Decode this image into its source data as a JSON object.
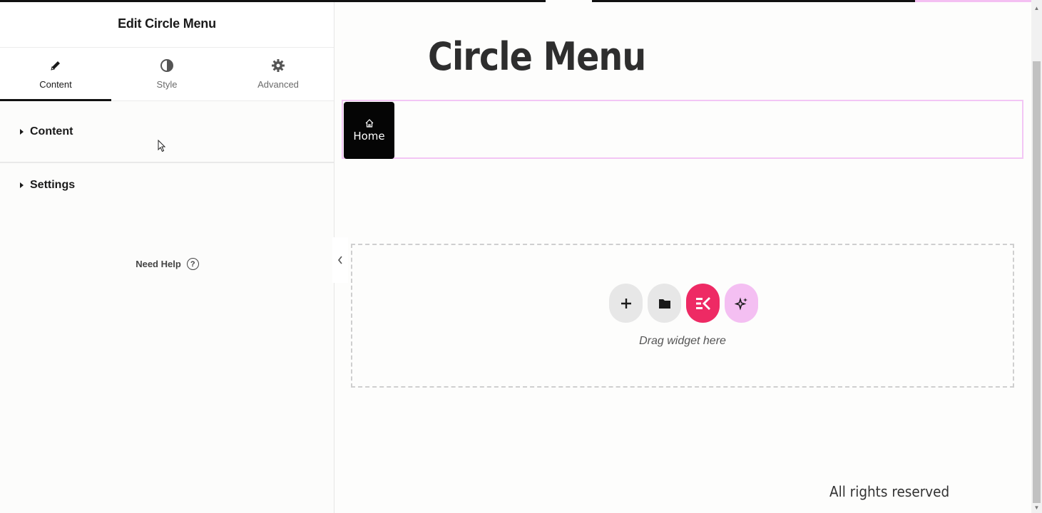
{
  "panel": {
    "title": "Edit Circle Menu",
    "tabs": [
      {
        "label": "Content",
        "icon": "pencil-icon",
        "active": true
      },
      {
        "label": "Style",
        "icon": "half-circle-icon",
        "active": false
      },
      {
        "label": "Advanced",
        "icon": "gear-icon",
        "active": false
      }
    ],
    "sections": [
      {
        "label": "Content"
      },
      {
        "label": "Settings"
      }
    ],
    "help_label": "Need Help",
    "help_icon": "question-icon",
    "collapse_icon": "chevron-left-icon"
  },
  "preview": {
    "page_title": "Circle Menu",
    "menu_item": {
      "label": "Home",
      "icon": "home-icon"
    },
    "dropzone": {
      "buttons": [
        {
          "name": "add-widget",
          "icon": "plus-icon",
          "color": "#e7e7e7"
        },
        {
          "name": "template-library",
          "icon": "folder-icon",
          "color": "#e7e7e7"
        },
        {
          "name": "elementskit",
          "icon": "elementskit-icon",
          "color": "#ee2a64"
        },
        {
          "name": "ai",
          "icon": "sparkle-icon",
          "color": "#f4bff2"
        }
      ],
      "hint": "Drag widget here"
    },
    "footer": "All rights reserved"
  },
  "colors": {
    "accent_pink": "#f3c6f5",
    "brand_red": "#ee2a64",
    "menu_bg": "#050505"
  }
}
